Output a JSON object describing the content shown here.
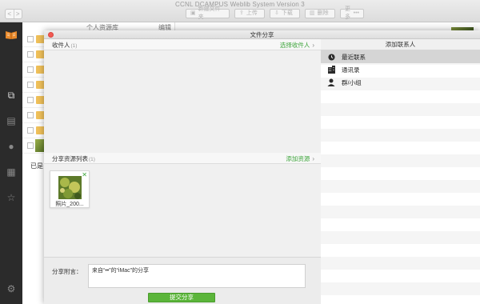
{
  "app": {
    "title": "CCNL DCAMPUS Weblib System Version 3",
    "nav_back": "<",
    "nav_forward": ">"
  },
  "toolbar": {
    "new_folder": "新建文件夹",
    "upload": "上传",
    "download": "下载",
    "delete": "删除",
    "more": "更多"
  },
  "filelist": {
    "header_title": "个人资源库",
    "header_edit": "编辑",
    "footer_text": "已是"
  },
  "modal": {
    "title": "文件分享",
    "recipients": {
      "label": "收件人",
      "count": "(1)",
      "action": "选择收件人"
    },
    "resources": {
      "label": "分享资源列表",
      "count": "(1)",
      "action": "添加资源",
      "items": [
        {
          "name": "照片_200..."
        }
      ]
    },
    "note": {
      "label": "分享附言：",
      "value": "来自“••”的“iMac”的分享"
    },
    "submit_label": "提交分享",
    "contacts": {
      "title": "添加联系人",
      "items": [
        {
          "label": "最近联系",
          "icon": "clock-icon",
          "selected": true
        },
        {
          "label": "通讯录",
          "icon": "building-icon",
          "selected": false
        },
        {
          "label": "群/小组",
          "icon": "group-icon",
          "selected": false
        }
      ]
    }
  },
  "colors": {
    "accent_green": "#3ea53c",
    "submit_green": "#5bb53a",
    "close_red": "#f25a53",
    "rail_dark": "#2b2b2b"
  }
}
